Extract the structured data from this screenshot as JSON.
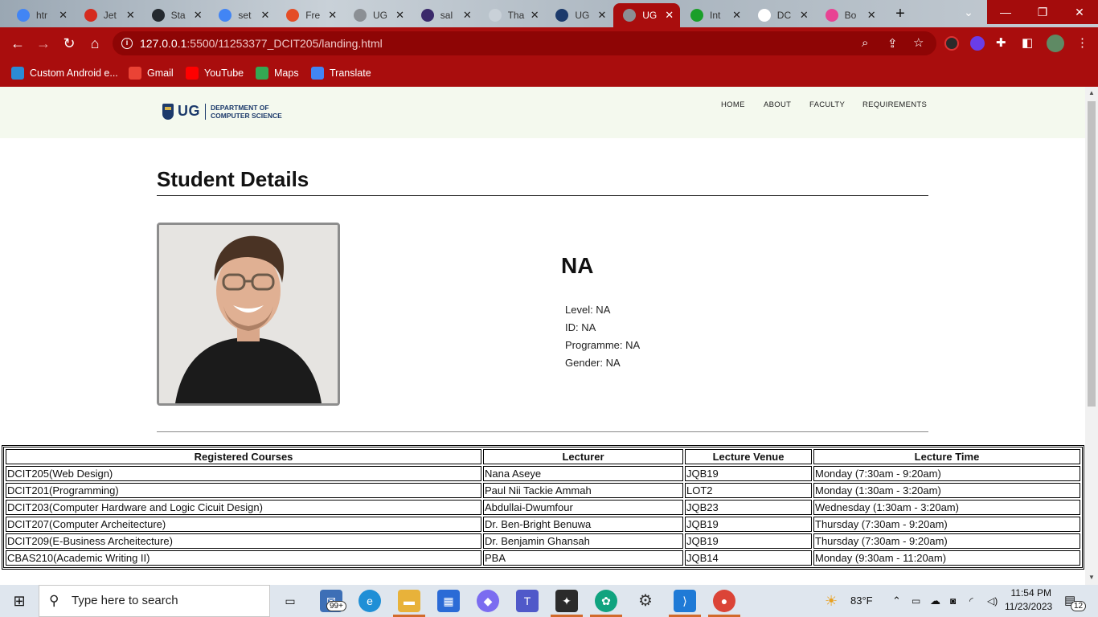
{
  "browser": {
    "tabs": [
      {
        "label": "htr",
        "favicon": "google-icon",
        "color": "#4285f4"
      },
      {
        "label": "Jet",
        "favicon": "swiss-flag-icon",
        "color": "#d52b1e"
      },
      {
        "label": "Sta",
        "favicon": "github-icon",
        "color": "#24292f"
      },
      {
        "label": "set",
        "favicon": "google-icon",
        "color": "#4285f4"
      },
      {
        "label": "Fre",
        "favicon": "html5-icon",
        "color": "#e44d26"
      },
      {
        "label": "UG",
        "favicon": "globe-icon",
        "color": "#8b8f94"
      },
      {
        "label": "sal",
        "favicon": "crest-icon",
        "color": "#3b2a6b"
      },
      {
        "label": "Tha",
        "favicon": "blank-icon",
        "color": "#c9d1d8"
      },
      {
        "label": "UG",
        "favicon": "ug-icon",
        "color": "#1c3a6b"
      },
      {
        "label": "UG",
        "favicon": "globe-icon",
        "color": "#8b8f94"
      },
      {
        "label": "Int",
        "favicon": "play-icon",
        "color": "#1a9f29"
      },
      {
        "label": "DC",
        "favicon": "github-icon",
        "color": "#ffffff"
      },
      {
        "label": "Bo",
        "favicon": "cube-icon",
        "color": "#e84393"
      }
    ],
    "active_tab_index": 9,
    "url_host": "127.0.0.1",
    "url_path": ":5500/11253377_DCIT205/landing.html",
    "bookmarks": [
      {
        "label": "Custom Android e...",
        "icon": "android-icon",
        "color": "#2b8bd6"
      },
      {
        "label": "Gmail",
        "icon": "gmail-icon",
        "color": "#ea4335"
      },
      {
        "label": "YouTube",
        "icon": "youtube-icon",
        "color": "#ff0000"
      },
      {
        "label": "Maps",
        "icon": "maps-icon",
        "color": "#34a853"
      },
      {
        "label": "Translate",
        "icon": "translate-icon",
        "color": "#4285f4"
      }
    ],
    "accent": "#a90d0d"
  },
  "site": {
    "logo_text": "UG",
    "dept_line1": "DEPARTMENT OF",
    "dept_line2": "COMPUTER SCIENCE",
    "nav": [
      "HOME",
      "ABOUT",
      "FACULTY",
      "REQUIREMENTS"
    ]
  },
  "student": {
    "heading": "Student Details",
    "name": "NA",
    "level": "Level: NA",
    "id": "ID: NA",
    "programme": "Programme: NA",
    "gender": "Gender: NA"
  },
  "courses": {
    "headers": [
      "Registered Courses",
      "Lecturer",
      "Lecture Venue",
      "Lecture Time"
    ],
    "rows": [
      [
        "DCIT205(Web Design)",
        "Nana Aseye",
        "JQB19",
        "Monday (7:30am - 9:20am)"
      ],
      [
        "DCIT201(Programming)",
        "Paul Nii Tackie Ammah",
        "LOT2",
        "Monday (1:30am - 3:20am)"
      ],
      [
        "DCIT203(Computer Hardware and Logic Cicuit Design)",
        "Abdullai-Dwumfour",
        "JQB23",
        "Wednesday (1:30am - 3:20am)"
      ],
      [
        "DCIT207(Computer Archeitecture)",
        "Dr. Ben-Bright Benuwa",
        "JQB19",
        "Thursday (7:30am - 9:20am)"
      ],
      [
        "DCIT209(E-Business Archeitecture)",
        "Dr. Benjamin Ghansah",
        "JQB19",
        "Thursday (7:30am - 9:20am)"
      ],
      [
        "CBAS210(Academic Writing II)",
        "PBA",
        "JQB14",
        "Monday (9:30am - 11:20am)"
      ]
    ]
  },
  "taskbar": {
    "search_placeholder": "Type here to search",
    "mail_badge": "99+",
    "weather": "83°F",
    "time": "11:54 PM",
    "date": "11/23/2023",
    "notifications": "12"
  }
}
